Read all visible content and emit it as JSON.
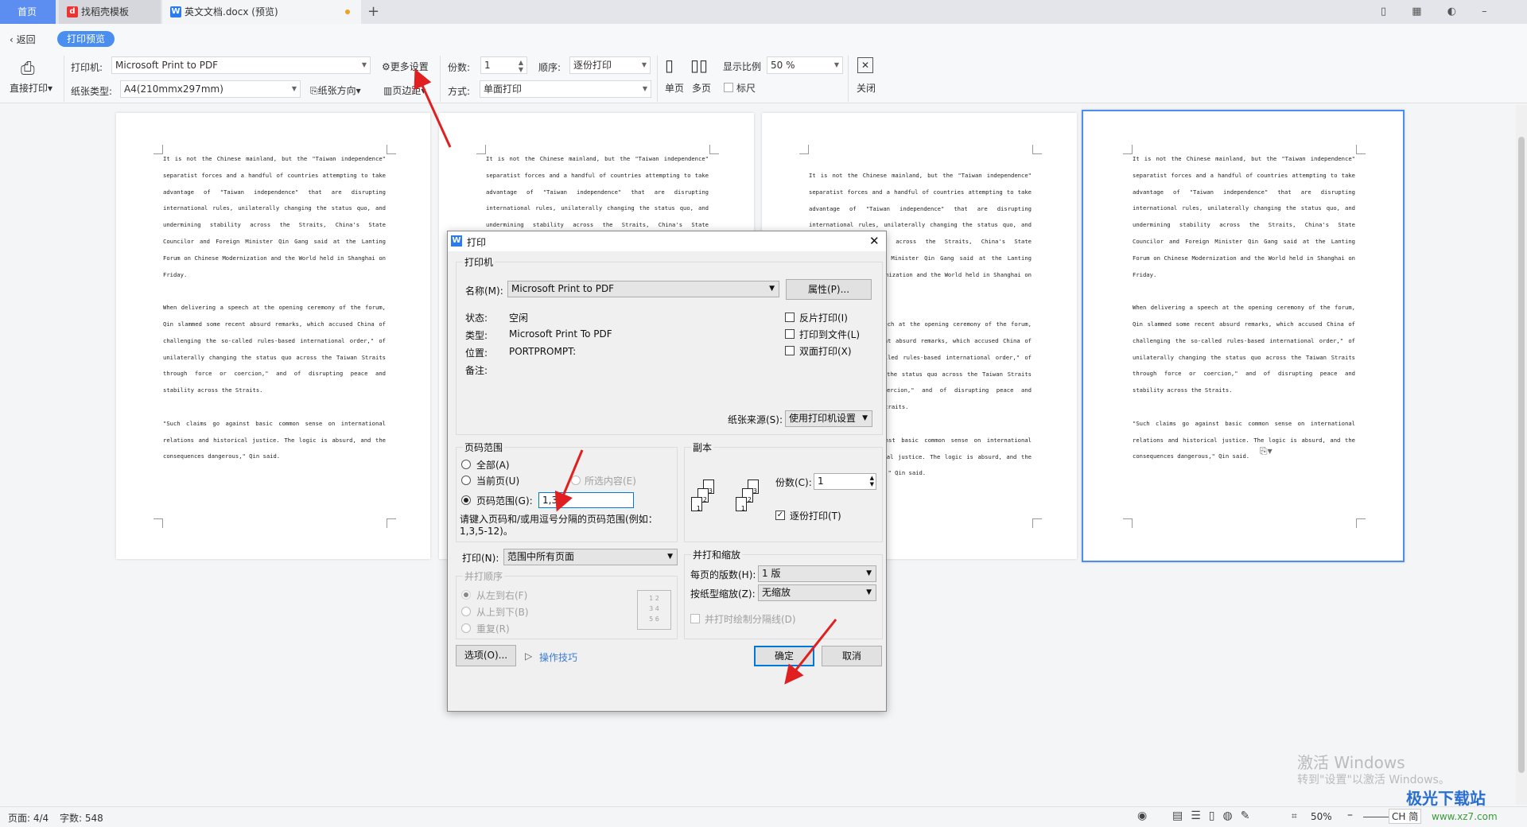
{
  "tabs": {
    "home": "首页",
    "template": "找稻壳模板",
    "doc": "英文文档.docx (预览)"
  },
  "nav": {
    "back": "返回",
    "mode": "打印预览"
  },
  "toolbar": {
    "direct_print": "直接打印",
    "printer_label": "打印机:",
    "printer": "Microsoft Print to PDF",
    "more_settings": "更多设置",
    "copies_label": "份数:",
    "copies": "1",
    "order_label": "顺序:",
    "order": "逐份打印",
    "paper_label": "纸张类型:",
    "paper": "A4(210mmx297mm)",
    "orientation": "纸张方向",
    "margins": "页边距",
    "mode_label": "方式:",
    "mode": "单面打印",
    "single": "单页",
    "multi": "多页",
    "zoom_label": "显示比例",
    "zoom": "50 %",
    "ruler": "标尺",
    "close": "关闭"
  },
  "page_text": {
    "p1": "It is not the Chinese mainland, but the \"Taiwan independence\" separatist forces and a handful of countries attempting to take advantage of \"Taiwan independence\" that are disrupting international rules, unilaterally changing the status quo, and undermining stability across the Straits, China's State Councilor and Foreign Minister Qin Gang said at the Lanting Forum on Chinese Modernization and the World held in Shanghai on Friday.",
    "p2": "When delivering a speech at the opening ceremony of the forum, Qin slammed some recent absurd remarks, which accused China of challenging the so-called rules-based international order,\" of unilaterally changing the status quo across the Taiwan Straits through force or coercion,\" and of disrupting peace and stability across the Straits.",
    "p3": "\"Such claims go against basic common sense on international relations and historical justice. The logic is absurd, and the consequences dangerous,\" Qin said."
  },
  "dialog": {
    "title": "打印",
    "printer_group": "打印机",
    "name_label": "名称(M):",
    "name": "Microsoft Print to PDF",
    "properties": "属性(P)...",
    "status_label": "状态:",
    "status": "空闲",
    "type_label": "类型:",
    "type": "Microsoft Print To PDF",
    "location_label": "位置:",
    "location": "PORTPROMPT:",
    "comment_label": "备注:",
    "reverse": "反片打印(I)",
    "to_file": "打印到文件(L)",
    "duplex": "双面打印(X)",
    "source_label": "纸张来源(S):",
    "source": "使用打印机设置",
    "range_group": "页码范围",
    "all": "全部(A)",
    "current": "当前页(U)",
    "selection": "所选内容(E)",
    "pages": "页码范围(G):",
    "pages_value": "1,3",
    "hint": "请键入页码和/或用逗号分隔的页码范围(例如：1,3,5-12)。",
    "copies_group": "副本",
    "copies_label": "份数(C):",
    "copies": "1",
    "collate": "逐份打印(T)",
    "print_label": "打印(N):",
    "print_what": "范围中所有页面",
    "order_group": "并打顺序",
    "ltr": "从左到右(F)",
    "ttb": "从上到下(B)",
    "repeat": "重复(R)",
    "zoom_group": "并打和缩放",
    "per_page_label": "每页的版数(H):",
    "per_page": "1 版",
    "scale_label": "按纸型缩放(Z):",
    "scale": "无缩放",
    "divider": "并打时绘制分隔线(D)",
    "options": "选项(O)...",
    "tips": "操作技巧",
    "ok": "确定",
    "cancel": "取消"
  },
  "status": {
    "page": "页面: 4/4",
    "words": "字数: 548",
    "zoom": "50%",
    "ime": "CH 简"
  },
  "watermark": {
    "line1": "激活 Windows",
    "line2": "转到\"设置\"以激活 Windows。",
    "logo": "极光下载站",
    "url": "www.xz7.com"
  },
  "colors": {
    "accent": "#4a8ef0",
    "arrow": "#e02020"
  }
}
